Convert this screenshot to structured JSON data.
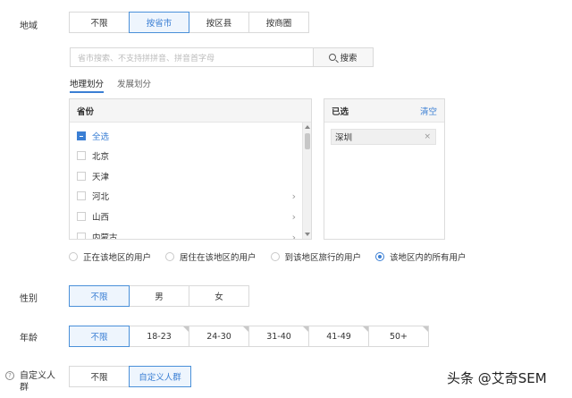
{
  "region": {
    "label": "地域",
    "options": [
      "不限",
      "按省市",
      "按区县",
      "按商圈"
    ],
    "selected": "按省市",
    "search_placeholder": "省市搜索、不支持拼拼音、拼音首字母",
    "search_button": "搜索",
    "subtabs": [
      "地理划分",
      "发展划分"
    ],
    "active_subtab": "地理划分",
    "province_panel": {
      "header": "省份",
      "items": [
        {
          "label": "全选",
          "checked": true,
          "has_children": false
        },
        {
          "label": "北京",
          "checked": false,
          "has_children": false
        },
        {
          "label": "天津",
          "checked": false,
          "has_children": false
        },
        {
          "label": "河北",
          "checked": false,
          "has_children": true
        },
        {
          "label": "山西",
          "checked": false,
          "has_children": true
        },
        {
          "label": "内蒙古",
          "checked": false,
          "has_children": true
        }
      ]
    },
    "selected_panel": {
      "header": "已选",
      "clear": "清空",
      "tags": [
        "深圳"
      ]
    },
    "user_types": [
      "正在该地区的用户",
      "居住在该地区的用户",
      "到该地区旅行的用户",
      "该地区内的所有用户"
    ],
    "selected_user_type": "该地区内的所有用户"
  },
  "gender": {
    "label": "性别",
    "options": [
      "不限",
      "男",
      "女"
    ],
    "selected": "不限"
  },
  "age": {
    "label": "年龄",
    "options": [
      "不限",
      "18-23",
      "24-30",
      "31-40",
      "41-49",
      "50+"
    ],
    "selected": "不限"
  },
  "custom_audience": {
    "label": "自定义人群",
    "options": [
      "不限",
      "自定义人群"
    ],
    "selected": "自定义人群"
  },
  "watermark": "头条 @艾奇SEM",
  "colors": {
    "accent": "#3b7fd4",
    "border": "#d9d9d9"
  }
}
